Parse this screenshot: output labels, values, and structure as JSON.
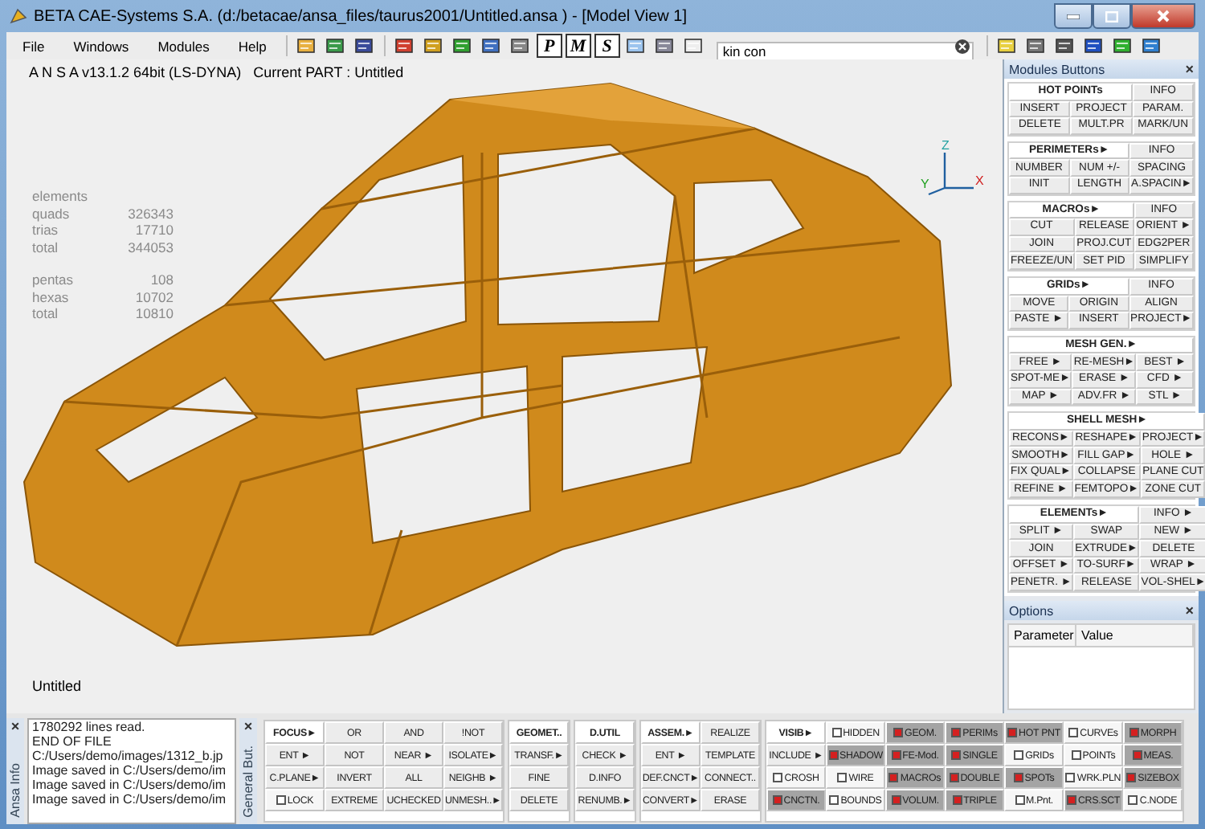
{
  "window": {
    "title": "BETA CAE-Systems S.A. (d:/betacae/ansa_files/taurus2001/Untitled.ansa ) - [Model View 1]"
  },
  "menu": [
    "File",
    "Windows",
    "Modules",
    "Help"
  ],
  "toolbar": {
    "letter_buttons": [
      "P",
      "M",
      "S"
    ],
    "search": {
      "value": "kin con"
    }
  },
  "viewport": {
    "header": "A N S A v13.1.2 64bit (LS-DYNA)   Current PART : Untitled",
    "axes": [
      "Z",
      "X",
      "Y"
    ],
    "footer": "Untitled",
    "stats": {
      "heading": "elements",
      "groups": [
        [
          {
            "label": "quads",
            "value": "326343"
          },
          {
            "label": "trias",
            "value": "17710"
          },
          {
            "label": "total",
            "value": "344053"
          }
        ],
        [
          {
            "label": "pentas",
            "value": "108"
          },
          {
            "label": "hexas",
            "value": "10702"
          },
          {
            "label": "total",
            "value": "10810"
          }
        ]
      ]
    }
  },
  "modules_panel": {
    "title": "Modules Buttons",
    "close": "×",
    "groups": [
      {
        "title": "HOT POINTs",
        "info": "INFO",
        "rows": [
          [
            "INSERT",
            "PROJECT",
            "PARAM."
          ],
          [
            "DELETE",
            "MULT.PR",
            "MARK/UN"
          ]
        ]
      },
      {
        "title": "PERIMETERs►",
        "info": "INFO",
        "rows": [
          [
            "NUMBER",
            "NUM +/-",
            "SPACING"
          ],
          [
            "INIT",
            "LENGTH",
            "A.SPACIN►"
          ]
        ]
      },
      {
        "title": "MACROs►",
        "info": "INFO",
        "rows": [
          [
            "CUT",
            "RELEASE",
            "ORIENT ►"
          ],
          [
            "JOIN",
            "PROJ.CUT",
            "EDG2PER"
          ],
          [
            "FREEZE/UN",
            "SET PID",
            "SIMPLIFY"
          ]
        ]
      },
      {
        "title": "GRIDs►",
        "info": "INFO",
        "rows": [
          [
            "MOVE",
            "ORIGIN",
            "ALIGN"
          ],
          [
            "PASTE ►",
            "INSERT",
            "PROJECT►"
          ]
        ]
      },
      {
        "title": "MESH GEN.►",
        "rows": [
          [
            "FREE ►",
            "RE-MESH►",
            "BEST ►"
          ],
          [
            "SPOT-ME►",
            "ERASE ►",
            "CFD ►"
          ],
          [
            "MAP ►",
            "ADV.FR ►",
            "STL ►"
          ]
        ]
      },
      {
        "title": "SHELL MESH►",
        "rows": [
          [
            "RECONS►",
            "RESHAPE►",
            "PROJECT►"
          ],
          [
            "SMOOTH►",
            "FILL GAP►",
            "HOLE ►"
          ],
          [
            "FIX QUAL►",
            "COLLAPSE",
            "PLANE CUT"
          ],
          [
            "REFINE ►",
            "FEMTOPO►",
            "ZONE CUT"
          ]
        ]
      },
      {
        "title": "ELEMENTs►",
        "info": "INFO ►",
        "rows": [
          [
            "SPLIT ►",
            "SWAP",
            "NEW ►"
          ],
          [
            "JOIN",
            "EXTRUDE►",
            "DELETE"
          ],
          [
            "OFFSET ►",
            "TO-SURF►",
            "WRAP ►"
          ],
          [
            "PENETR. ►",
            "RELEASE",
            "VOL-SHEL►"
          ]
        ]
      }
    ]
  },
  "options_panel": {
    "title": "Options",
    "close": "×",
    "columns": [
      "Parameter",
      "Value"
    ]
  },
  "info_panel": {
    "tab": "Ansa Info",
    "close": "×",
    "lines": [
      "1780292 lines read.",
      "END OF FILE",
      "C:/Users/demo/images/1312_b.jp",
      "Image saved in C:/Users/demo/im",
      "Image saved in C:/Users/demo/im",
      "Image saved in C:/Users/demo/im"
    ]
  },
  "general_panel": {
    "tab": "General But.",
    "close": "×",
    "groups": [
      {
        "cells": [
          {
            "kind": "header",
            "label": "FOCUS►"
          },
          {
            "kind": "button",
            "label": "OR"
          },
          {
            "kind": "button",
            "label": "AND"
          },
          {
            "kind": "button",
            "label": "!NOT"
          },
          {
            "kind": "button",
            "label": "ENT ►"
          },
          {
            "kind": "button",
            "label": "NOT"
          },
          {
            "kind": "button",
            "label": "NEAR ►"
          },
          {
            "kind": "button",
            "label": "ISOLATE►"
          },
          {
            "kind": "button",
            "label": "C.PLANE►"
          },
          {
            "kind": "button",
            "label": "INVERT"
          },
          {
            "kind": "button",
            "label": "ALL"
          },
          {
            "kind": "button",
            "label": "NEIGHB ►"
          },
          {
            "kind": "toggle",
            "label": "LOCK",
            "checked": false
          },
          {
            "kind": "button",
            "label": "EXTREME"
          },
          {
            "kind": "button",
            "label": "UCHECKED"
          },
          {
            "kind": "button",
            "label": "UNMESH..►"
          }
        ]
      },
      {
        "cells": [
          {
            "kind": "header",
            "label": "GEOMET.."
          },
          {
            "kind": "button",
            "label": "TRANSF.►"
          },
          {
            "kind": "button",
            "label": "FINE"
          },
          {
            "kind": "button",
            "label": "DELETE"
          }
        ]
      },
      {
        "cells": [
          {
            "kind": "header",
            "label": "D.UTIL"
          },
          {
            "kind": "button",
            "label": "CHECK ►"
          },
          {
            "kind": "button",
            "label": "D.INFO"
          },
          {
            "kind": "button",
            "label": "RENUMB.►"
          }
        ]
      },
      {
        "cells": [
          {
            "kind": "header",
            "label": "ASSEM.►"
          },
          {
            "kind": "button",
            "label": "REALIZE"
          },
          {
            "kind": "button",
            "label": "ENT ►"
          },
          {
            "kind": "button",
            "label": "TEMPLATE"
          },
          {
            "kind": "button",
            "label": "DEF.CNCT►"
          },
          {
            "kind": "button",
            "label": "CONNECT.."
          },
          {
            "kind": "button",
            "label": "CONVERT►"
          },
          {
            "kind": "button",
            "label": "ERASE"
          }
        ]
      },
      {
        "cells": [
          {
            "kind": "header",
            "label": "VISIB►"
          },
          {
            "kind": "toggle",
            "label": "HIDDEN",
            "checked": false
          },
          {
            "kind": "toggle",
            "label": "GEOM.",
            "checked": true
          },
          {
            "kind": "toggle",
            "label": "PERIMs",
            "checked": true
          },
          {
            "kind": "toggle",
            "label": "HOT PNT",
            "checked": true
          },
          {
            "kind": "toggle",
            "label": "CURVEs",
            "checked": false
          },
          {
            "kind": "toggle",
            "label": "MORPH",
            "checked": true
          },
          {
            "kind": "button",
            "label": "INCLUDE ►"
          },
          {
            "kind": "toggle",
            "label": "SHADOW",
            "checked": true
          },
          {
            "kind": "toggle",
            "label": "FE-Mod.",
            "checked": true
          },
          {
            "kind": "toggle",
            "label": "SINGLE",
            "checked": true
          },
          {
            "kind": "toggle",
            "label": "GRIDs",
            "checked": false
          },
          {
            "kind": "toggle",
            "label": "POINTs",
            "checked": false
          },
          {
            "kind": "toggle",
            "label": "MEAS.",
            "checked": true
          },
          {
            "kind": "toggle",
            "label": "CROSH",
            "checked": false
          },
          {
            "kind": "toggle",
            "label": "WIRE",
            "checked": false
          },
          {
            "kind": "toggle",
            "label": "MACROs",
            "checked": true
          },
          {
            "kind": "toggle",
            "label": "DOUBLE",
            "checked": true
          },
          {
            "kind": "toggle",
            "label": "SPOTs",
            "checked": true
          },
          {
            "kind": "toggle",
            "label": "WRK.PLN",
            "checked": false
          },
          {
            "kind": "toggle",
            "label": "SIZEBOX",
            "checked": true
          },
          {
            "kind": "toggle",
            "label": "CNCTN.",
            "checked": true
          },
          {
            "kind": "toggle",
            "label": "BOUNDS",
            "checked": false
          },
          {
            "kind": "toggle",
            "label": "VOLUM.",
            "checked": true
          },
          {
            "kind": "toggle",
            "label": "TRIPLE",
            "checked": true
          },
          {
            "kind": "toggle",
            "label": "M.Pnt.",
            "checked": false
          },
          {
            "kind": "toggle",
            "label": "CRS.SCT",
            "checked": true
          },
          {
            "kind": "toggle",
            "label": "C.NODE",
            "checked": false
          }
        ]
      }
    ]
  }
}
